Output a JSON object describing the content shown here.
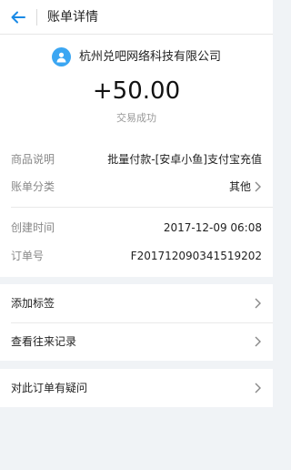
{
  "header": {
    "title": "账单详情"
  },
  "summary": {
    "merchant": "杭州兑吧网络科技有限公司",
    "amount": "+50.00",
    "status": "交易成功"
  },
  "details": [
    {
      "label": "商品说明",
      "value": "批量付款-[安卓小鱼]支付宝充值"
    },
    {
      "label": "账单分类",
      "value": "其他"
    },
    {
      "label": "创建时间",
      "value": "2017-12-09 06:08"
    },
    {
      "label": "订单号",
      "value": "F201712090341519202"
    }
  ],
  "actions": [
    {
      "label": "添加标签"
    },
    {
      "label": "查看往来记录"
    },
    {
      "label": "对此订单有疑问"
    }
  ],
  "colors": {
    "accent": "#1a8ae6",
    "avatar": "#3ba6f2",
    "background": "#f0f3f6"
  },
  "icons": {
    "back": "arrow-left-icon",
    "merchant": "user-avatar-icon",
    "chevron": "chevron-right-icon"
  }
}
